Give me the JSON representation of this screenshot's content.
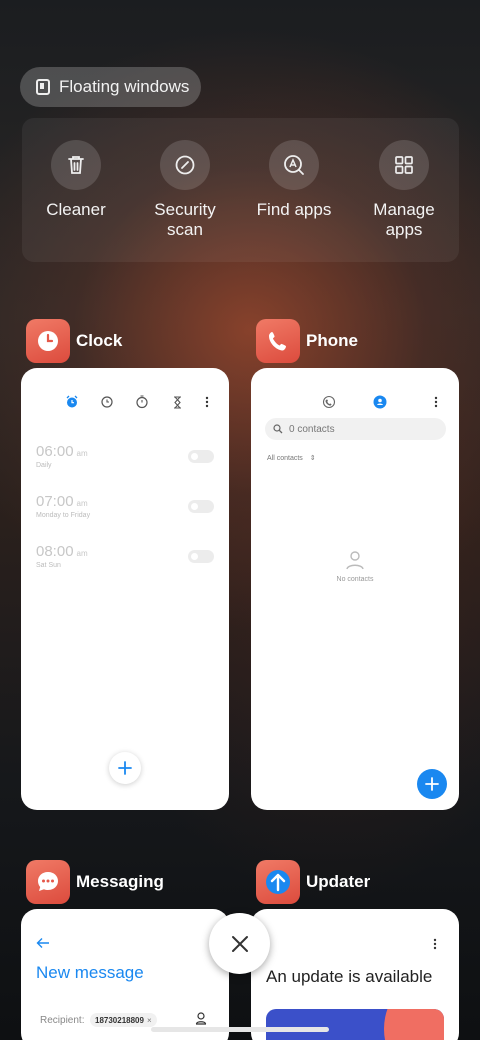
{
  "floating_windows": {
    "label": "Floating windows",
    "icon": "floating-window-icon"
  },
  "tools": [
    {
      "label_1": "Cleaner",
      "label_2": "",
      "icon": "trash-icon"
    },
    {
      "label_1": "Security",
      "label_2": "scan",
      "icon": "security-scan-icon"
    },
    {
      "label_1": "Find apps",
      "label_2": "",
      "icon": "find-apps-icon"
    },
    {
      "label_1": "Manage",
      "label_2": "apps",
      "icon": "grid-icon"
    }
  ],
  "apps": {
    "clock": {
      "name": "Clock",
      "alarms": [
        {
          "time": "06:00",
          "ampm": "am",
          "repeat": "Daily"
        },
        {
          "time": "07:00",
          "ampm": "am",
          "repeat": "Monday to Friday"
        },
        {
          "time": "08:00",
          "ampm": "am",
          "repeat": "Sat Sun"
        }
      ]
    },
    "phone": {
      "name": "Phone",
      "search_placeholder": "0 contacts",
      "filter": "All contacts",
      "empty": "No contacts"
    },
    "messaging": {
      "name": "Messaging",
      "title": "New message",
      "recipient_label": "Recipient:",
      "recipient_chip": "18730218809",
      "chip_remove": "×"
    },
    "updater": {
      "name": "Updater",
      "title": "An update is available"
    }
  },
  "colors": {
    "accent_blue": "#1a88f0",
    "app_icon_red": "#e5584a"
  }
}
